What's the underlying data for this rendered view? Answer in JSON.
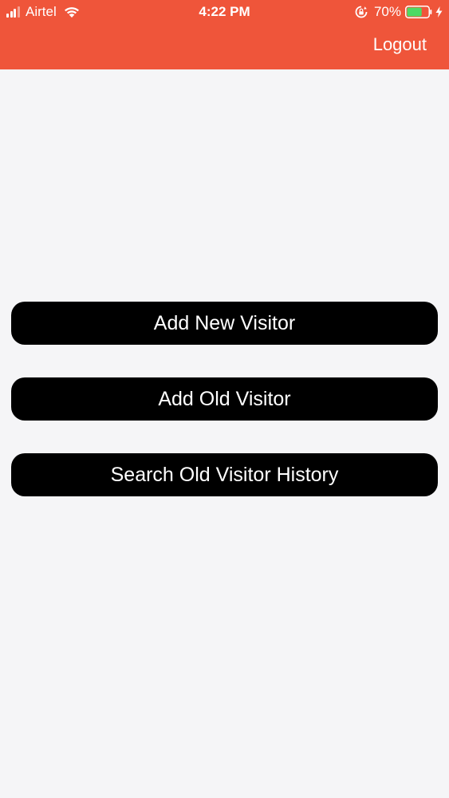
{
  "status_bar": {
    "carrier": "Airtel",
    "time": "4:22 PM",
    "battery_percent": "70%",
    "battery_level": 0.7,
    "icons": [
      "signal-icon",
      "wifi-icon",
      "rotation-lock-icon",
      "battery-icon",
      "charging-bolt-icon"
    ]
  },
  "header": {
    "background_color": "#ef553a",
    "logout_label": "Logout"
  },
  "menu": {
    "buttons": [
      {
        "label": "Add New Visitor"
      },
      {
        "label": "Add Old Visitor"
      },
      {
        "label": "Search Old Visitor History"
      }
    ]
  },
  "colors": {
    "button_bg": "#000000",
    "button_text": "#ffffff",
    "page_bg": "#f5f5f7",
    "battery_fill": "#4cd964"
  }
}
